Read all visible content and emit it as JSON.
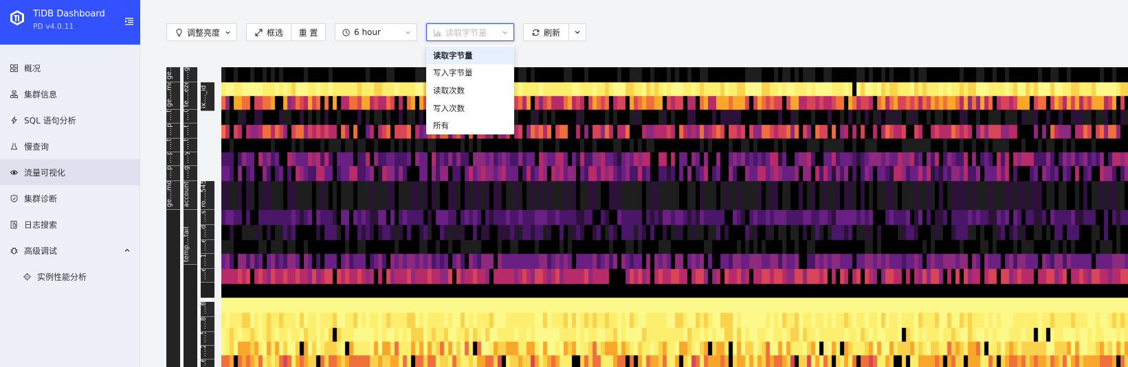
{
  "brand": {
    "title": "TiDB Dashboard",
    "version": "PD v4.0.11",
    "color": "#3351ff"
  },
  "sidebar": {
    "items": [
      {
        "label": "概况",
        "icon": "dashboard-grid-icon"
      },
      {
        "label": "集群信息",
        "icon": "cluster-icon"
      },
      {
        "label": "SQL 语句分析",
        "icon": "lightning-icon"
      },
      {
        "label": "慢查询",
        "icon": "flask-icon"
      },
      {
        "label": "流量可视化",
        "icon": "eye-icon",
        "active": true
      },
      {
        "label": "集群诊断",
        "icon": "shield-check-icon"
      },
      {
        "label": "日志搜索",
        "icon": "log-search-icon"
      },
      {
        "label": "高级调试",
        "icon": "bug-icon",
        "expanded": true
      },
      {
        "label": "实例性能分析",
        "icon": "target-icon",
        "sub": true
      }
    ]
  },
  "toolbar": {
    "brightness_label": "调整亮度",
    "brush_label": "框选",
    "reset_label": "重 置",
    "time_range": "6 hour",
    "metric_selected": "读取字节量",
    "refresh_label": "刷新"
  },
  "metric_dropdown": {
    "options": [
      "读取字节量",
      "写入字节量",
      "读取次数",
      "写入次数",
      "所有"
    ],
    "selected_index": 0
  },
  "heatmap": {
    "axis_db": [
      "ge....mdp....p",
      "ge....mdp....p"
    ],
    "axis_table": [
      "....g",
      "te....eze",
      "....G",
      "....y",
      "....g",
      "account",
      "temp....tail"
    ],
    "axis_index": [
      "ix...._id",
      "ro....545",
      "....s",
      "....d",
      "....e",
      "....1",
      "....e",
      "....8",
      "....8",
      "....5",
      "....2",
      "....6"
    ],
    "palette": [
      "#000000",
      "#1e1e1e",
      "#2c1139",
      "#4a1668",
      "#6a1f83",
      "#8e2a7e",
      "#b72b6b",
      "#d94558",
      "#f0703d",
      "#f9a72b",
      "#fbd24b",
      "#fdee6e",
      "#fcf98a"
    ]
  }
}
